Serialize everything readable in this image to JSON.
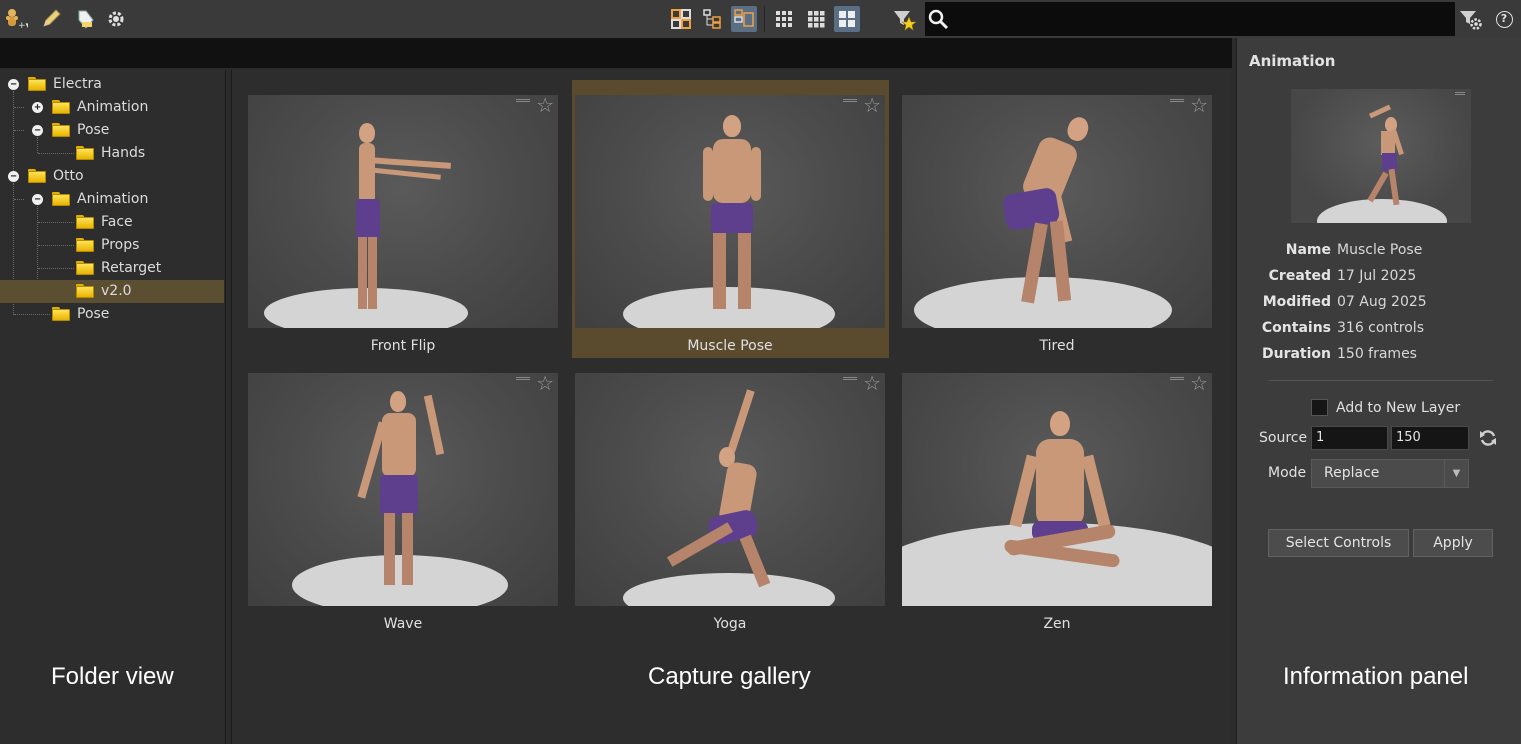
{
  "toolbar": {
    "left_icons": [
      "add-figure-icon",
      "pencil-icon",
      "tag-icon",
      "gear-icon"
    ],
    "layout_icons": [
      "grid-layout-icon",
      "tree-layout-icon",
      "split-layout-icon"
    ],
    "size_icons": [
      "small-thumbs-icon",
      "medium-thumbs-icon",
      "large-thumbs-icon"
    ],
    "active_layout": "split-layout-icon",
    "active_size": "large-thumbs-icon",
    "search": {
      "value": "",
      "placeholder": ""
    },
    "right_icons": [
      "filter-settings-icon",
      "help-icon"
    ],
    "help_glyph": "?"
  },
  "folders": [
    {
      "label": "Electra",
      "depth": 0,
      "toggle": "−"
    },
    {
      "label": "Animation",
      "depth": 1,
      "toggle": "+"
    },
    {
      "label": "Pose",
      "depth": 1,
      "toggle": "−"
    },
    {
      "label": "Hands",
      "depth": 2,
      "toggle": ""
    },
    {
      "label": "Otto",
      "depth": 0,
      "toggle": "−"
    },
    {
      "label": "Animation",
      "depth": 1,
      "toggle": "−"
    },
    {
      "label": "Face",
      "depth": 2,
      "toggle": ""
    },
    {
      "label": "Props",
      "depth": 2,
      "toggle": ""
    },
    {
      "label": "Retarget",
      "depth": 2,
      "toggle": ""
    },
    {
      "label": "v2.0",
      "depth": 2,
      "toggle": "",
      "selected": true
    },
    {
      "label": "Pose",
      "depth": 1,
      "toggle": ""
    }
  ],
  "gallery": {
    "items": [
      {
        "label": "Front Flip",
        "selected": false
      },
      {
        "label": "Muscle Pose",
        "selected": true
      },
      {
        "label": "Tired",
        "selected": false
      },
      {
        "label": "Wave",
        "selected": false
      },
      {
        "label": "Yoga",
        "selected": false
      },
      {
        "label": "Zen",
        "selected": false
      }
    ],
    "star_glyph": "☆"
  },
  "info": {
    "title": "Animation",
    "fields": [
      {
        "key": "Name",
        "value": "Muscle Pose"
      },
      {
        "key": "Created",
        "value": "17 Jul 2025"
      },
      {
        "key": "Modified",
        "value": "07 Aug 2025"
      },
      {
        "key": "Contains",
        "value": "316 controls"
      },
      {
        "key": "Duration",
        "value": "150 frames"
      }
    ],
    "add_to_new_layer_label": "Add to New Layer",
    "add_to_new_layer_checked": false,
    "source_label": "Source",
    "source_start": "1",
    "source_end": "150",
    "mode_label": "Mode",
    "mode_value": "Replace",
    "select_controls_label": "Select Controls",
    "apply_label": "Apply"
  },
  "captions": {
    "folder_view": "Folder view",
    "capture_gallery": "Capture gallery",
    "information_panel": "Information panel"
  },
  "colors": {
    "selection": "#5c4e31",
    "active_button": "#5a6f86",
    "folder_yellow": "#f2c51c",
    "shorts_purple": "#5d3f8e"
  }
}
